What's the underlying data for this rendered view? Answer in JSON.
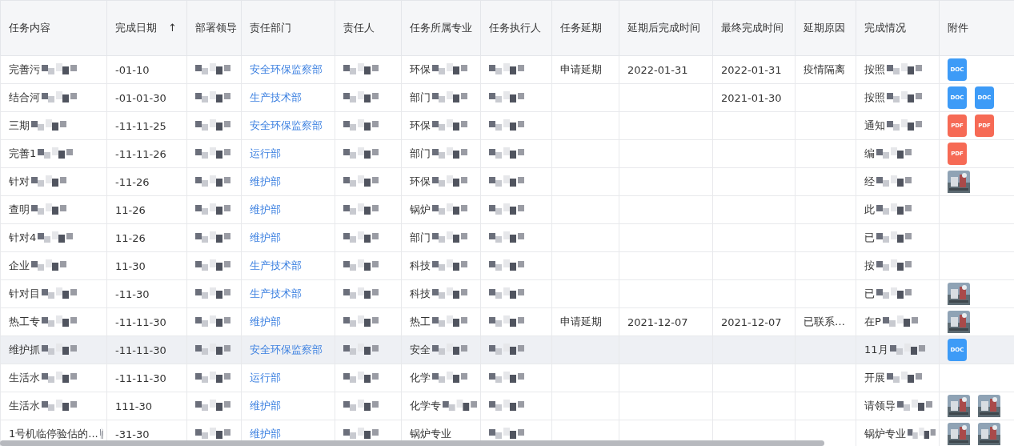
{
  "table": {
    "columns": [
      {
        "label": "任务内容",
        "masked": true
      },
      {
        "label": "完成日期",
        "sort": "↑",
        "masked": false
      },
      {
        "label": "部署领导",
        "masked": true
      },
      {
        "label": "责任部门",
        "masked": false
      },
      {
        "label": "责任人",
        "masked": true
      },
      {
        "label": "任务所属专业",
        "masked": true
      },
      {
        "label": "任务执行人",
        "masked": true
      },
      {
        "label": "任务延期",
        "masked": false
      },
      {
        "label": "延期后完成时间",
        "masked": false
      },
      {
        "label": "最终完成时间",
        "masked": false
      },
      {
        "label": "延期原因",
        "masked": false
      },
      {
        "label": "完成情况",
        "masked": true
      },
      {
        "label": "附件",
        "masked": false
      }
    ],
    "rows": [
      {
        "selected": false,
        "cells": [
          "完善污",
          "-01-10",
          "",
          "安全环保监察部",
          "",
          "环保",
          "",
          "申请延期",
          "2022-01-31",
          "2022-01-31",
          "疫情隔离",
          "按照"
        ],
        "attachments": [
          {
            "kind": "doc",
            "label": "DOC"
          }
        ]
      },
      {
        "selected": false,
        "cells": [
          "结合河",
          "-01-01-30",
          "",
          "生产技术部",
          "",
          "部门",
          "",
          "",
          "",
          "2021-01-30",
          "",
          "按照"
        ],
        "attachments": [
          {
            "kind": "doc",
            "label": "DOC"
          },
          {
            "kind": "doc",
            "label": "DOC"
          }
        ]
      },
      {
        "selected": false,
        "cells": [
          "三期",
          "-11-11-25",
          "",
          "安全环保监察部",
          "",
          "环保",
          "",
          "",
          "",
          "",
          "",
          "通知"
        ],
        "attachments": [
          {
            "kind": "pdf",
            "label": "PDF"
          },
          {
            "kind": "pdf",
            "label": "PDF"
          }
        ]
      },
      {
        "selected": false,
        "cells": [
          "完善1",
          "-11-11-26",
          "",
          "运行部",
          "",
          "部门",
          "",
          "",
          "",
          "",
          "",
          "编"
        ],
        "attachments": [
          {
            "kind": "pdf",
            "label": "PDF"
          }
        ]
      },
      {
        "selected": false,
        "cells": [
          "针对",
          "-11-26",
          "",
          "维护部",
          "",
          "环保",
          "",
          "",
          "",
          "",
          "",
          "经"
        ],
        "attachments": [
          {
            "kind": "picture"
          }
        ]
      },
      {
        "selected": false,
        "cells": [
          "查明",
          "11-26",
          "",
          "维护部",
          "",
          "锅炉",
          "",
          "",
          "",
          "",
          "",
          "此"
        ],
        "attachments": []
      },
      {
        "selected": false,
        "cells": [
          "针对4",
          "11-26",
          "",
          "维护部",
          "",
          "部门",
          "",
          "",
          "",
          "",
          "",
          "已"
        ],
        "attachments": []
      },
      {
        "selected": false,
        "cells": [
          "企业",
          "11-30",
          "",
          "生产技术部",
          "",
          "科技",
          "",
          "",
          "",
          "",
          "",
          "按"
        ],
        "attachments": []
      },
      {
        "selected": false,
        "cells": [
          "针对目",
          "-11-30",
          "",
          "生产技术部",
          "",
          "科技",
          "",
          "",
          "",
          "",
          "",
          "已"
        ],
        "attachments": [
          {
            "kind": "picture"
          }
        ]
      },
      {
        "selected": false,
        "cells": [
          "热工专",
          "-11-11-30",
          "",
          "维护部",
          "",
          "热工",
          "",
          "申请延期",
          "2021-12-07",
          "2021-12-07",
          "已联系…",
          "在P"
        ],
        "attachments": [
          {
            "kind": "picture"
          }
        ]
      },
      {
        "selected": true,
        "cells": [
          "维护抓",
          "-11-11-30",
          "",
          "安全环保监察部",
          "",
          "安全",
          "",
          "",
          "",
          "",
          "",
          "11月"
        ],
        "attachments": [
          {
            "kind": "doc",
            "label": "DOC"
          }
        ]
      },
      {
        "selected": false,
        "cells": [
          "生活水",
          "-11-11-30",
          "",
          "运行部",
          "",
          "化学",
          "",
          "",
          "",
          "",
          "",
          "开展"
        ],
        "attachments": []
      },
      {
        "selected": false,
        "cells": [
          "生活水",
          "111-30",
          "",
          "维护部",
          "",
          "化学专",
          "",
          "",
          "",
          "",
          "",
          "请领导"
        ],
        "attachments": [
          {
            "kind": "picture"
          },
          {
            "kind": "picture"
          }
        ]
      },
      {
        "selected": false,
        "cells": [
          "1号机临停验估的...",
          "-31-30",
          "",
          "维护部",
          "",
          "锅炉专业",
          "",
          "",
          "",
          "",
          "",
          "锅炉专业"
        ],
        "attachments": [
          {
            "kind": "picture"
          },
          {
            "kind": "picture"
          }
        ]
      }
    ]
  }
}
